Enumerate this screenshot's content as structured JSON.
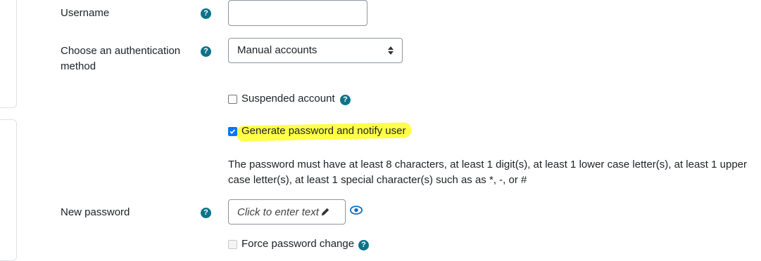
{
  "fields": {
    "username": {
      "label": "Username",
      "value": ""
    },
    "auth": {
      "label": "Choose an authentication method",
      "selected": "Manual accounts"
    },
    "suspended": {
      "label": "Suspended account",
      "checked": false
    },
    "generate_password": {
      "label": "Generate password and notify user",
      "checked": true
    },
    "password_rules": "The password must have at least 8 characters, at least 1 digit(s), at least 1 lower case letter(s), at least 1 upper case letter(s), at least 1 special character(s) such as as *, -, or #",
    "new_password": {
      "label": "New password",
      "placeholder": "Click to enter text"
    },
    "force_change": {
      "label": "Force password change",
      "checked": false
    }
  },
  "help_icon_text": "?",
  "colors": {
    "help": "#0a7389",
    "checkbox_checked": "#0075ff",
    "highlight": "#ffff33"
  }
}
